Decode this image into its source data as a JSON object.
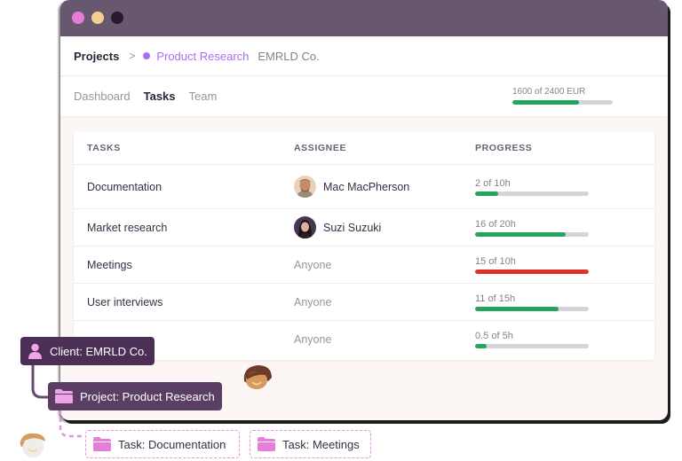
{
  "window": {
    "traffic_lights": [
      "close",
      "minimize",
      "maximize"
    ]
  },
  "breadcrumb": {
    "root": "Projects",
    "separator": ">",
    "project": "Product Research",
    "client": "EMRLD Co.",
    "project_color": "#a96ef0"
  },
  "tabs": [
    {
      "label": "Dashboard",
      "active": false
    },
    {
      "label": "Tasks",
      "active": true
    },
    {
      "label": "Team",
      "active": false
    }
  ],
  "budget": {
    "label": "1600 of 2400 EUR",
    "used": 1600,
    "total": 2400,
    "color": "#22a55d"
  },
  "table": {
    "headers": [
      "TASKS",
      "ASSIGNEE",
      "PROGRESS"
    ],
    "rows": [
      {
        "task": "Documentation",
        "assignee": "Mac MacPherson",
        "avatar": "mac-avatar",
        "progress_label": "2 of 10h",
        "done": 2,
        "total": 10,
        "status": "ok"
      },
      {
        "task": "Market research",
        "assignee": "Suzi Suzuki",
        "avatar": "suzi-avatar",
        "progress_label": "16 of 20h",
        "done": 16,
        "total": 20,
        "status": "ok"
      },
      {
        "task": "Meetings",
        "assignee": "Anyone",
        "avatar": null,
        "progress_label": "15 of 10h",
        "done": 15,
        "total": 10,
        "status": "over"
      },
      {
        "task": "User interviews",
        "assignee": "Anyone",
        "avatar": null,
        "progress_label": "11 of 15h",
        "done": 11,
        "total": 15,
        "status": "ok"
      },
      {
        "task": "",
        "assignee": "Anyone",
        "avatar": null,
        "progress_label": "0.5 of 5h",
        "done": 0.5,
        "total": 5,
        "status": "ok"
      }
    ]
  },
  "colors": {
    "ok": "#22a55d",
    "over": "#e0302a",
    "track": "#d8d3da"
  },
  "hierarchy": {
    "client": {
      "label": "Client: EMRLD Co.",
      "icon": "person-icon"
    },
    "project": {
      "label": "Project: Product Research",
      "icon": "folder-icon"
    },
    "tasks": [
      {
        "label": "Task: Documentation",
        "icon": "folder-icon"
      },
      {
        "label": "Task: Meetings",
        "icon": "folder-icon"
      }
    ]
  }
}
